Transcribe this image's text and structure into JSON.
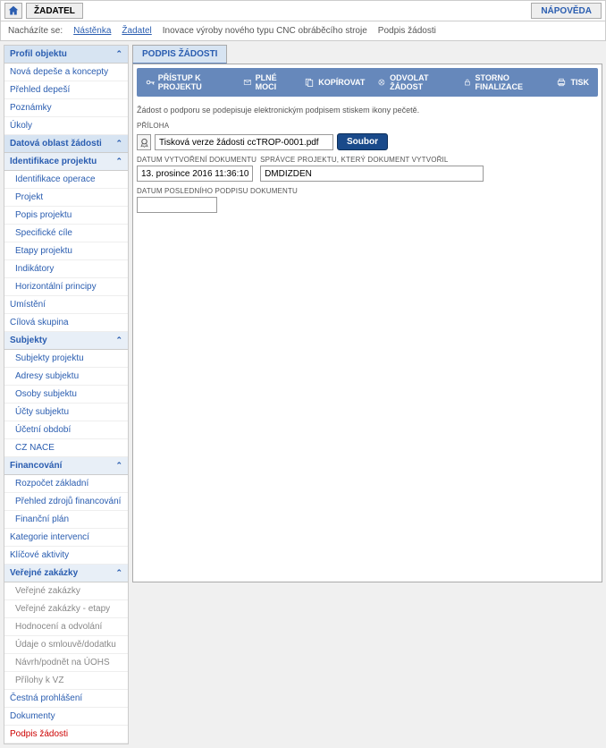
{
  "topbar": {
    "zadatel": "ŽADATEL",
    "napoveda": "NÁPOVĚDA"
  },
  "breadcrumb": {
    "prefix": "Nacházíte se:",
    "items": [
      "Nástěnka",
      "Žadatel",
      "Inovace výroby nového typu CNC obráběcího stroje",
      "Podpis žádosti"
    ]
  },
  "sidebar": {
    "profil": {
      "title": "Profil objektu"
    },
    "profil_items": [
      "Nová depeše a koncepty",
      "Přehled depeší",
      "Poznámky",
      "Úkoly"
    ],
    "datova": {
      "title": "Datová oblast žádosti"
    },
    "ident": {
      "title": "Identifikace projektu"
    },
    "ident_items": [
      "Identifikace operace",
      "Projekt",
      "Popis projektu",
      "Specifické cíle",
      "Etapy projektu",
      "Indikátory",
      "Horizontální principy"
    ],
    "umisteni": "Umístění",
    "cilova": "Cílová skupina",
    "subjekty": {
      "title": "Subjekty"
    },
    "subjekty_items": [
      "Subjekty projektu",
      "Adresy subjektu",
      "Osoby subjektu",
      "Účty subjektu",
      "Účetní období",
      "CZ NACE"
    ],
    "financovani": {
      "title": "Financování"
    },
    "financovani_items": [
      "Rozpočet základní",
      "Přehled zdrojů financování",
      "Finanční plán"
    ],
    "kategorie": "Kategorie intervencí",
    "klicove": "Klíčové aktivity",
    "verejne": {
      "title": "Veřejné zakázky"
    },
    "verejne_items": [
      "Veřejné zakázky",
      "Veřejné zakázky - etapy",
      "Hodnocení a odvolání",
      "Údaje o smlouvě/dodatku",
      "Návrh/podnět na ÚOHS",
      "Přílohy k VZ"
    ],
    "cestne": "Čestná prohlášení",
    "dokumenty": "Dokumenty",
    "podpis": "Podpis žádosti"
  },
  "content": {
    "tab": "PODPIS ŽÁDOSTI",
    "toolbar": {
      "pristup": "PŘÍSTUP K PROJEKTU",
      "plne": "PLNÉ MOCI",
      "kopirovat": "KOPÍROVAT",
      "odvolat": "ODVOLAT ŽÁDOST",
      "storno": "STORNO FINALIZACE",
      "tisk": "TISK"
    },
    "info": "Žádost o podporu se podepisuje elektronickým podpisem stiskem ikony pečetě.",
    "fields": {
      "priloha_label": "PŘÍLOHA",
      "priloha_value": "Tisková verze žádosti ccTROP-0001.pdf",
      "soubor_btn": "Soubor",
      "datum_vytvoreni_label": "DATUM VYTVOŘENÍ DOKUMENTU",
      "datum_vytvoreni_value": "13. prosince 2016 11:36:10",
      "spravce_label": "SPRÁVCE PROJEKTU, KTERÝ DOKUMENT VYTVOŘIL",
      "spravce_value": "DMDIZDEN",
      "datum_podpisu_label": "DATUM POSLEDNÍHO PODPISU DOKUMENTU",
      "datum_podpisu_value": ""
    }
  }
}
